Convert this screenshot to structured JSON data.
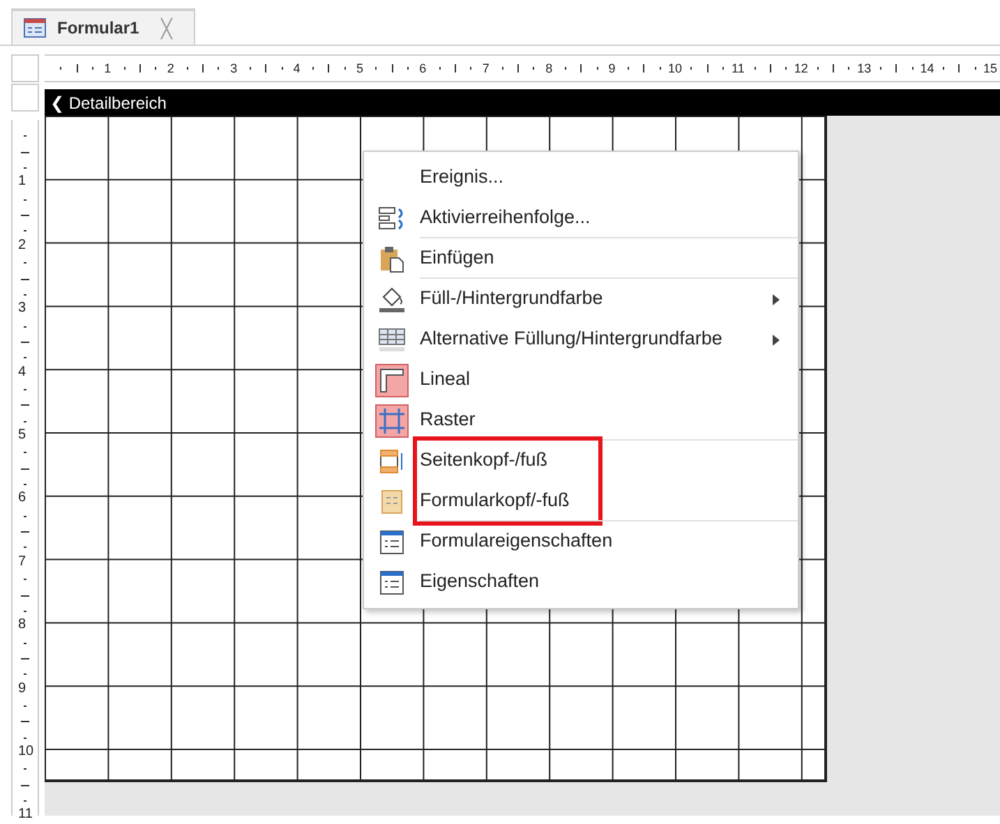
{
  "tabs": [
    {
      "label": "Formular1",
      "close": "╳",
      "selected": true
    }
  ],
  "ruler": {
    "horizontal": [
      "1",
      "2",
      "3",
      "4",
      "5",
      "6",
      "7",
      "8",
      "9",
      "10",
      "11",
      "12",
      "13",
      "14",
      "15"
    ],
    "vertical": [
      "1",
      "2",
      "3",
      "4",
      "5",
      "6",
      "7",
      "8",
      "9",
      "10",
      "11"
    ]
  },
  "section": {
    "title": "Detailbereich",
    "glyph": "❮"
  },
  "context_menu": {
    "items": [
      {
        "kind": "none",
        "label": "Ereignis...",
        "checked": false,
        "submenu": false,
        "highlighted": false,
        "separator_after": false
      },
      {
        "kind": "tab-order",
        "label": "Aktivierreihenfolge...",
        "checked": false,
        "submenu": false,
        "highlighted": false,
        "separator_after": true
      },
      {
        "kind": "paste",
        "label": "Einfügen",
        "checked": false,
        "submenu": false,
        "highlighted": false,
        "separator_after": true
      },
      {
        "kind": "fill",
        "label": "Füll-/Hintergrundfarbe",
        "checked": false,
        "submenu": true,
        "highlighted": false,
        "separator_after": false
      },
      {
        "kind": "alt-fill",
        "label": "Alternative Füllung/Hintergrundfarbe",
        "checked": false,
        "submenu": true,
        "highlighted": false,
        "separator_after": false
      },
      {
        "kind": "ruler",
        "label": "Lineal",
        "checked": true,
        "submenu": false,
        "highlighted": false,
        "separator_after": false
      },
      {
        "kind": "grid",
        "label": "Raster",
        "checked": true,
        "submenu": false,
        "highlighted": false,
        "separator_after": true
      },
      {
        "kind": "page-header",
        "label": "Seitenkopf-/fuß",
        "checked": false,
        "submenu": false,
        "highlighted": true,
        "separator_after": false
      },
      {
        "kind": "form-header",
        "label": "Formularkopf/-fuß",
        "checked": false,
        "submenu": false,
        "highlighted": true,
        "separator_after": true
      },
      {
        "kind": "properties",
        "label": "Formulareigenschaften",
        "checked": false,
        "submenu": false,
        "highlighted": false,
        "separator_after": false
      },
      {
        "kind": "properties",
        "label": "Eigenschaften",
        "checked": false,
        "submenu": false,
        "highlighted": false,
        "separator_after": false
      }
    ]
  }
}
